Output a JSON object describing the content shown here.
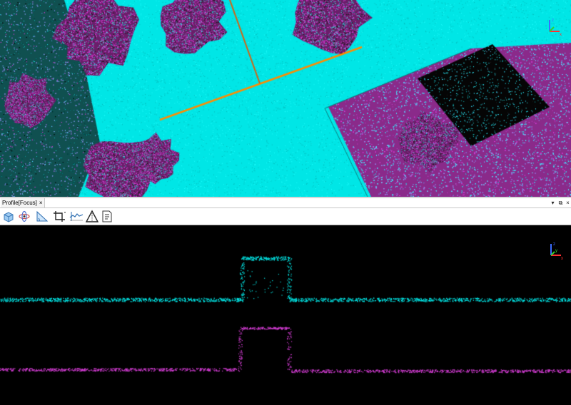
{
  "window": {
    "panel_title": "Profile[Focus]",
    "close_glyph": "×",
    "pin_glyph": "▾",
    "float_glyph": "⧉",
    "panel_close_glyph": "×"
  },
  "toolbar": {
    "icons": [
      "cube-view-icon",
      "orbit-icon",
      "measure-slope-icon",
      "crop-icon",
      "profile-height-icon",
      "triangle-measure-icon",
      "report-icon"
    ]
  },
  "colors": {
    "ground": "#00e6e6",
    "vegetation": "#d13cd1",
    "profile_line": "#ff8c00",
    "profile_line_dark": "#d26414",
    "background": "#000000"
  },
  "axes": {
    "x": "x",
    "y": "y",
    "z": "z"
  }
}
